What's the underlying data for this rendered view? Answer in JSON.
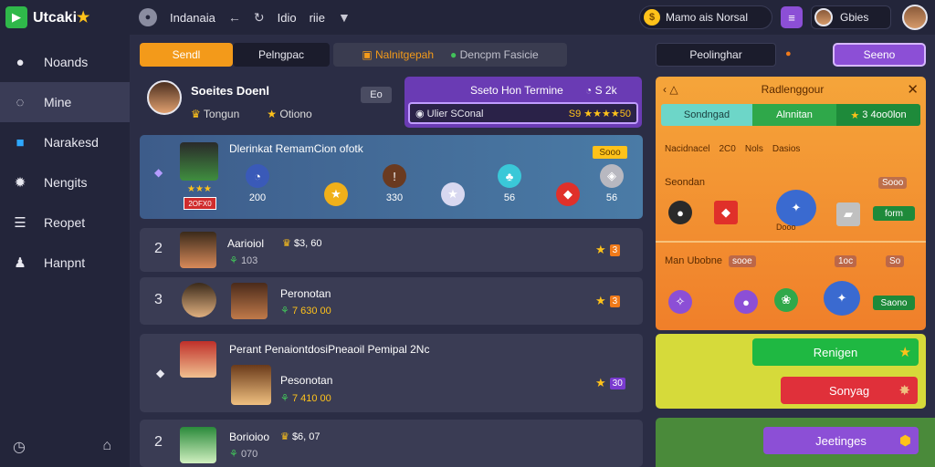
{
  "app": {
    "logo_text": "Utcaki",
    "logo_star": "★"
  },
  "top_nav": {
    "title": "Indanaia",
    "item1": "Idio",
    "item2": "riie"
  },
  "top_right": {
    "coin_label": "Mamo ais Norsal",
    "user_label": "Gbies"
  },
  "sidebar": {
    "items": [
      {
        "label": "Noands",
        "icon": "pin-icon"
      },
      {
        "label": "Mine",
        "icon": "search-icon"
      },
      {
        "label": "Narakesd",
        "icon": "news-icon"
      },
      {
        "label": "Nengits",
        "icon": "gear-icon"
      },
      {
        "label": "Reopet",
        "icon": "list-icon"
      },
      {
        "label": "Hanpnt",
        "icon": "people-icon"
      }
    ],
    "active_index": 1
  },
  "tabs": {
    "tab1": "Sendl",
    "tab2": "Pelngpac",
    "tab3a": "Nalnitgepah",
    "tab3b": "Dencpm Fasicie"
  },
  "header": {
    "title": "Soeites Doenl",
    "tag": "Eo",
    "sub1": "Tongun",
    "sub2": "Otiono"
  },
  "purple_panel": {
    "title": "Sseto Hon Termine",
    "value": "S 2k",
    "row_label": "Ulier SConal",
    "row_value": "S9 ★★★★50"
  },
  "featured": {
    "title": "Dlerinkat RemamCion ofotk",
    "gold_badge": "Sooo",
    "stars": "★★★",
    "badge": "2OFX0",
    "gems": [
      {
        "icon": "clock-icon",
        "color": "#3a5ab8",
        "label": "200"
      },
      {
        "icon": "star-icon",
        "color": "#f0b01a",
        "label": ""
      },
      {
        "icon": "info-icon",
        "color": "#6a3a20",
        "label": "330"
      },
      {
        "icon": "star-icon",
        "color": "#d8d8f0",
        "label": ""
      },
      {
        "icon": "rabbit-icon",
        "color": "#3ac8d8",
        "label": "56"
      },
      {
        "icon": "gem-icon",
        "color": "#e0302a",
        "label": ""
      },
      {
        "icon": "shield-icon",
        "color": "#b8b8c0",
        "label": "56"
      }
    ]
  },
  "rows": [
    {
      "rank": "2",
      "name": "Aarioiol",
      "coins": "$3, 60",
      "sub": "103",
      "badge": "3"
    },
    {
      "rank": "3",
      "name": "Peronotan",
      "coins": "",
      "sub": "7 630 00",
      "badge": "3"
    },
    {
      "rank": "",
      "name": "Pesonotan",
      "coins": "",
      "sub": "7 410 00",
      "badge": "30",
      "title": "Perant PenaiontdosiPneaoil Pemipal 2Nc"
    },
    {
      "rank": "2",
      "name": "Borioioo",
      "coins": "$6, 07",
      "sub": "070",
      "badge": ""
    }
  ],
  "right_panel": {
    "tab": "Peolinghar",
    "button": "Seeno",
    "shop": {
      "title": "Radlenggour",
      "tab_a": "Sondngad",
      "tab_b": "Alnnitan",
      "tab_c": "3 4oo0lon",
      "line": "Nacidnacel",
      "line_a": "2C0",
      "line_b": "Nols",
      "line_c": "Dasios",
      "section1": "Seondan",
      "price1": "Sooo",
      "green1": "form",
      "sub_label": "Dooo",
      "section2": "Man Ubobne",
      "price2": "sooe",
      "price3": "1oc",
      "price4": "So",
      "green2": "Saono"
    },
    "cta1": "Renigen",
    "cta2": "Sonyag",
    "cta3": "Jeetinges"
  },
  "colors": {
    "accent_orange": "#f39a1a",
    "accent_purple": "#8c4fd6",
    "gold": "#ffc21a",
    "green": "#42c25a"
  }
}
